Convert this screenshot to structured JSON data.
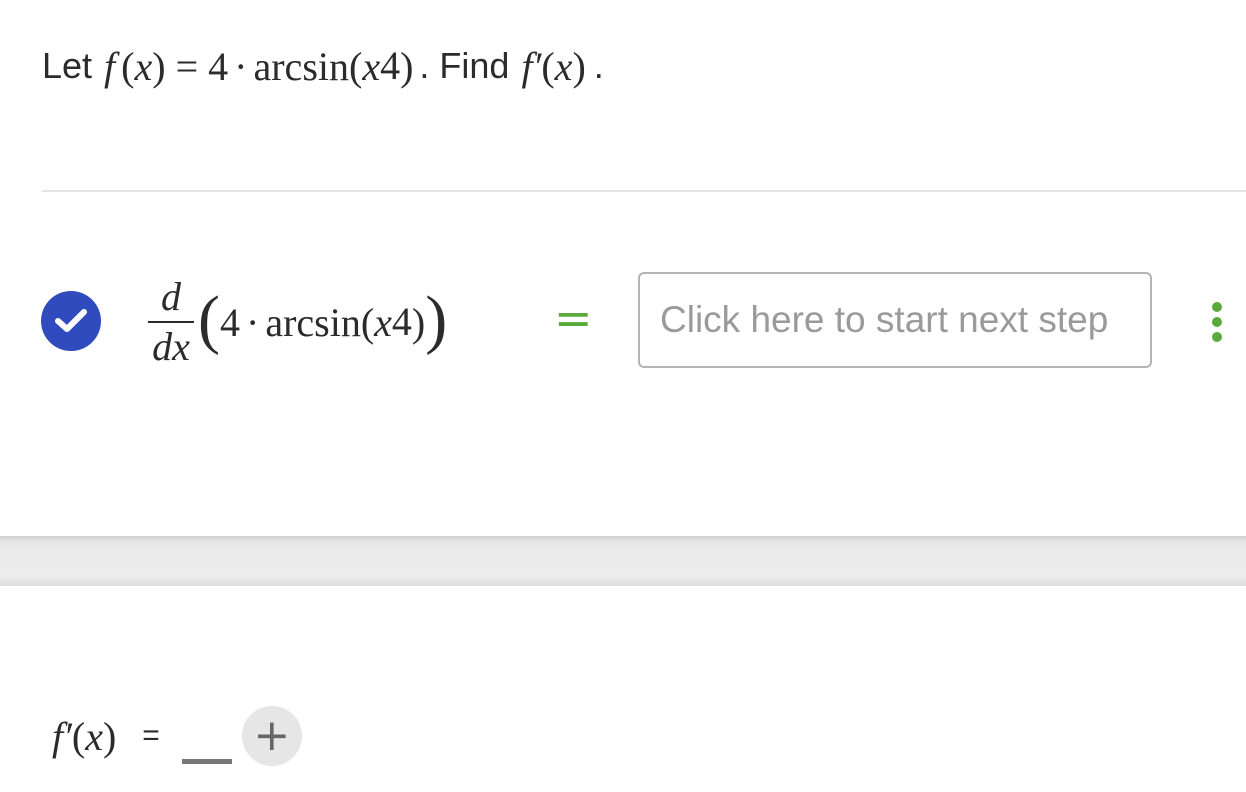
{
  "problem": {
    "lead": "Let",
    "func": "f",
    "arg": "x",
    "eq": "=",
    "coef": "4",
    "dot": "·",
    "trig": "arcsin",
    "base": "x",
    "exponent": "4",
    "find_label": ". Find",
    "deriv": "f′",
    "end": "."
  },
  "step": {
    "status": "check-icon",
    "d_num": "d",
    "d_den": "dx",
    "coef": "4",
    "dot": "·",
    "trig": "arcsin",
    "base": "x",
    "exponent": "4",
    "equals": "=",
    "next_step_placeholder": "Click here to start next step",
    "menu_icon": "kebab-menu-icon"
  },
  "answer": {
    "deriv": "f′",
    "arg": "x",
    "eq": "=",
    "add_label": "+"
  },
  "colors": {
    "check_badge": "#2f4bbd",
    "accent_green": "#5aaa3b"
  }
}
